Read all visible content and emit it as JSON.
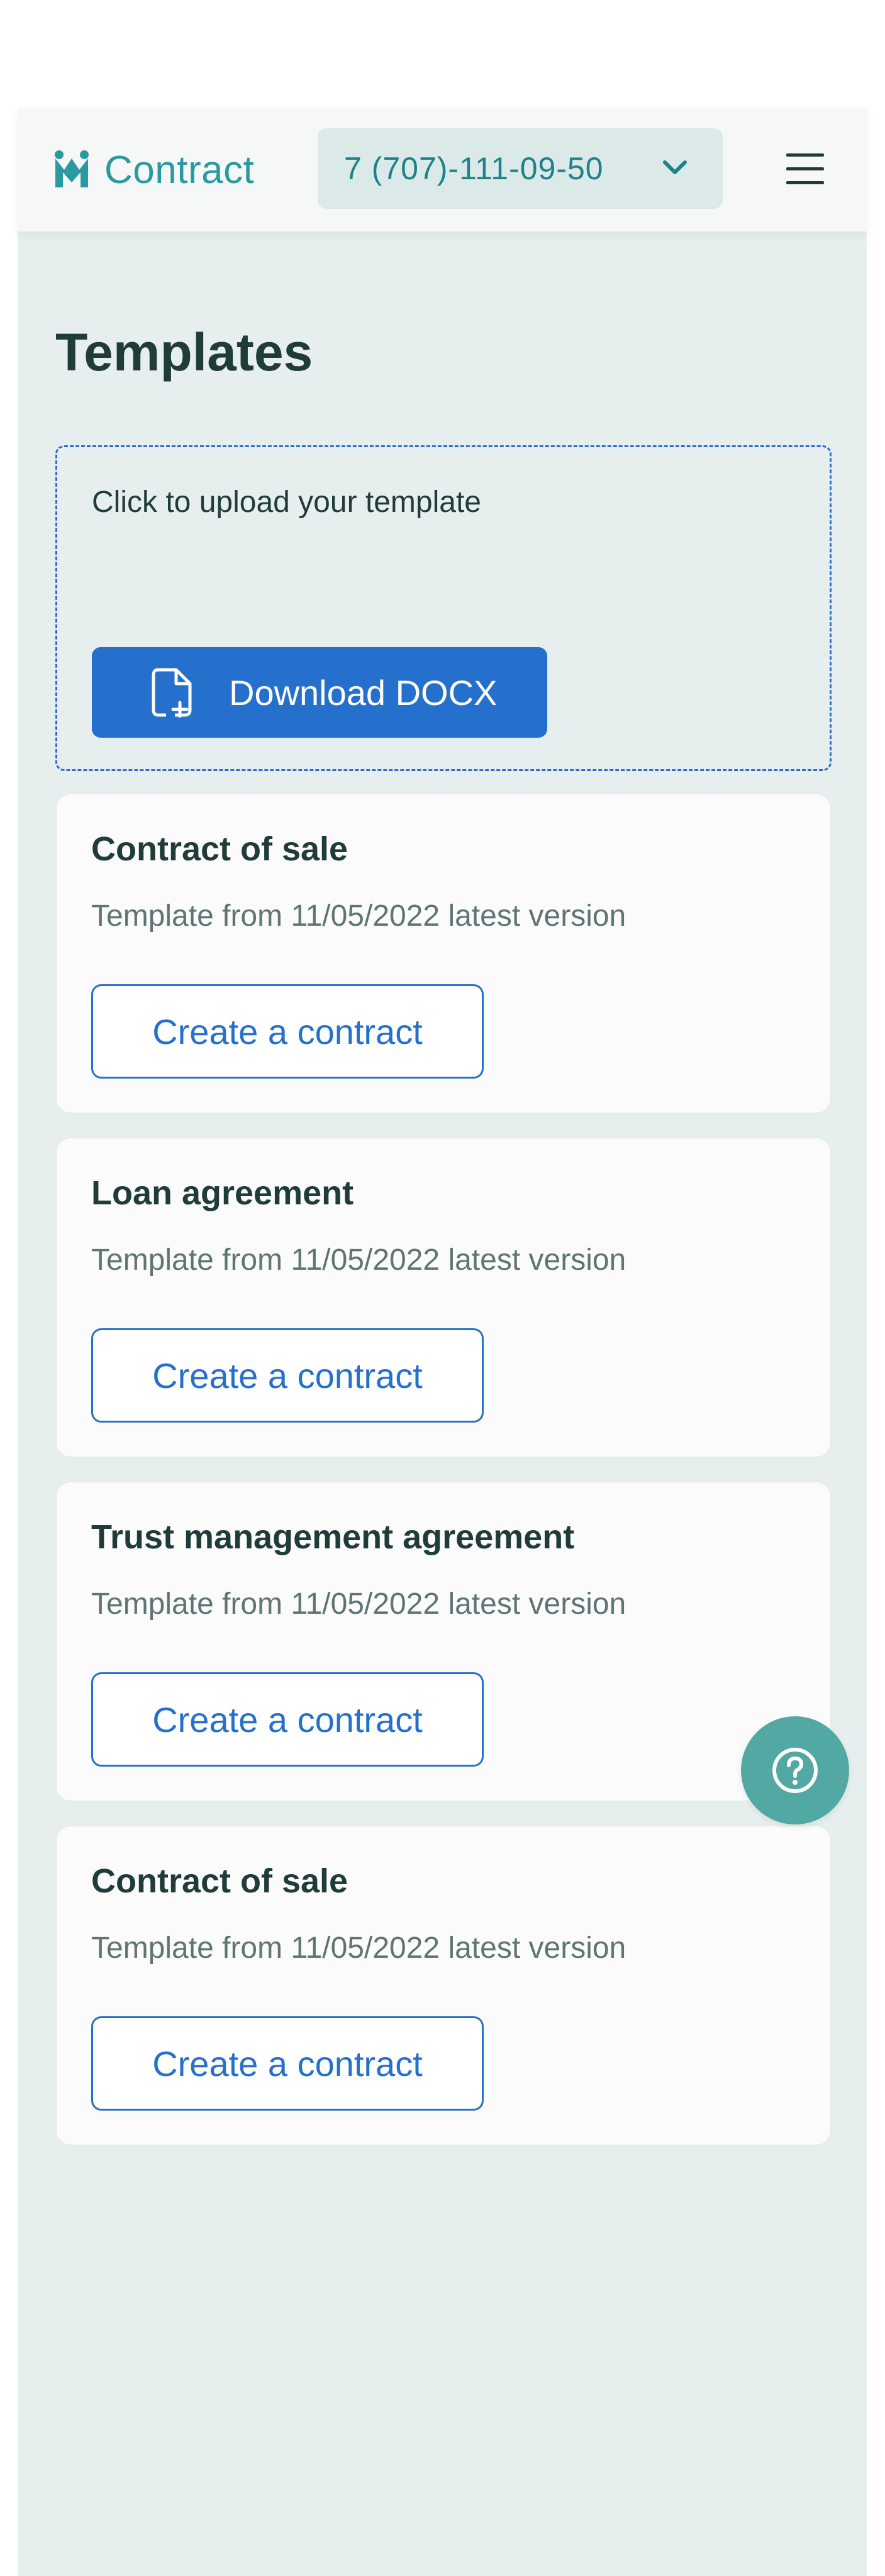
{
  "header": {
    "logo_text": "Contract",
    "phone_number": "7 (707)-111-09-50"
  },
  "page": {
    "title": "Templates"
  },
  "upload": {
    "hint": "Click to upload your template",
    "button_label": "Download DOCX"
  },
  "templates": [
    {
      "title": "Contract of sale",
      "subtitle": "Template from 11/05/2022 latest version",
      "action": "Create a contract"
    },
    {
      "title": "Loan agreement",
      "subtitle": "Template from 11/05/2022 latest version",
      "action": "Create a contract"
    },
    {
      "title": "Trust management agreement",
      "subtitle": "Template from 11/05/2022 latest version",
      "action": "Create a contract"
    },
    {
      "title": "Contract of sale",
      "subtitle": "Template from 11/05/2022 latest version",
      "action": "Create a contract"
    }
  ],
  "icons": {
    "logo": "logo-icon",
    "phone_dropdown": "chevron-down-icon",
    "menu": "hamburger-menu-icon",
    "upload": "file-plus-icon",
    "help": "question-icon"
  },
  "colors": {
    "brand_teal": "#2a9aa0",
    "primary_blue": "#2470cc",
    "page_background": "#e7efee",
    "text_dark": "#1f3b3a",
    "help_button": "#52a8a2"
  }
}
